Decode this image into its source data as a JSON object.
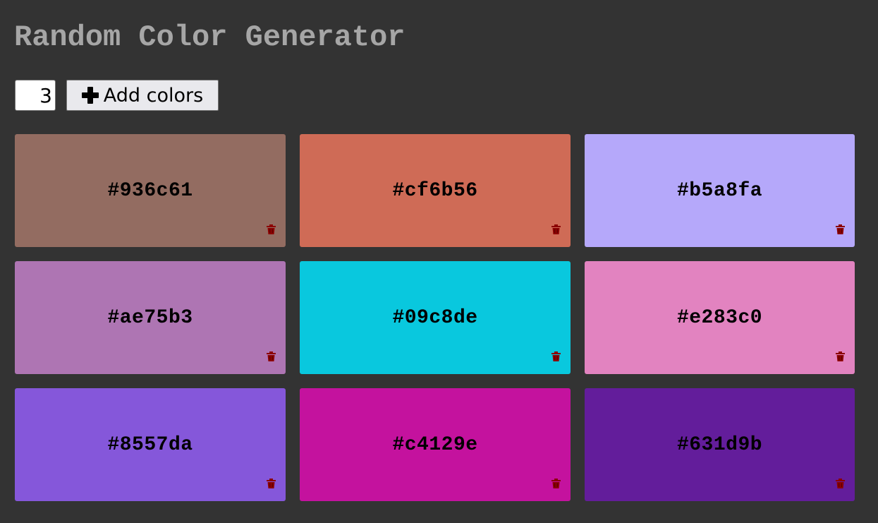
{
  "title": "Random Color Generator",
  "controls": {
    "count_value": "3",
    "add_button_label": "Add colors",
    "add_button_icon": "plus-icon"
  },
  "trash_color": "#8b0000",
  "colors": [
    {
      "hex": "#936c61",
      "bg": "#936c61"
    },
    {
      "hex": "#cf6b56",
      "bg": "#cf6b56"
    },
    {
      "hex": "#b5a8fa",
      "bg": "#b5a8fa"
    },
    {
      "hex": "#ae75b3",
      "bg": "#ae75b3"
    },
    {
      "hex": "#09c8de",
      "bg": "#09c8de"
    },
    {
      "hex": "#e283c0",
      "bg": "#e283c0"
    },
    {
      "hex": "#8557da",
      "bg": "#8557da"
    },
    {
      "hex": "#c4129e",
      "bg": "#c4129e"
    },
    {
      "hex": "#631d9b",
      "bg": "#631d9b"
    }
  ]
}
